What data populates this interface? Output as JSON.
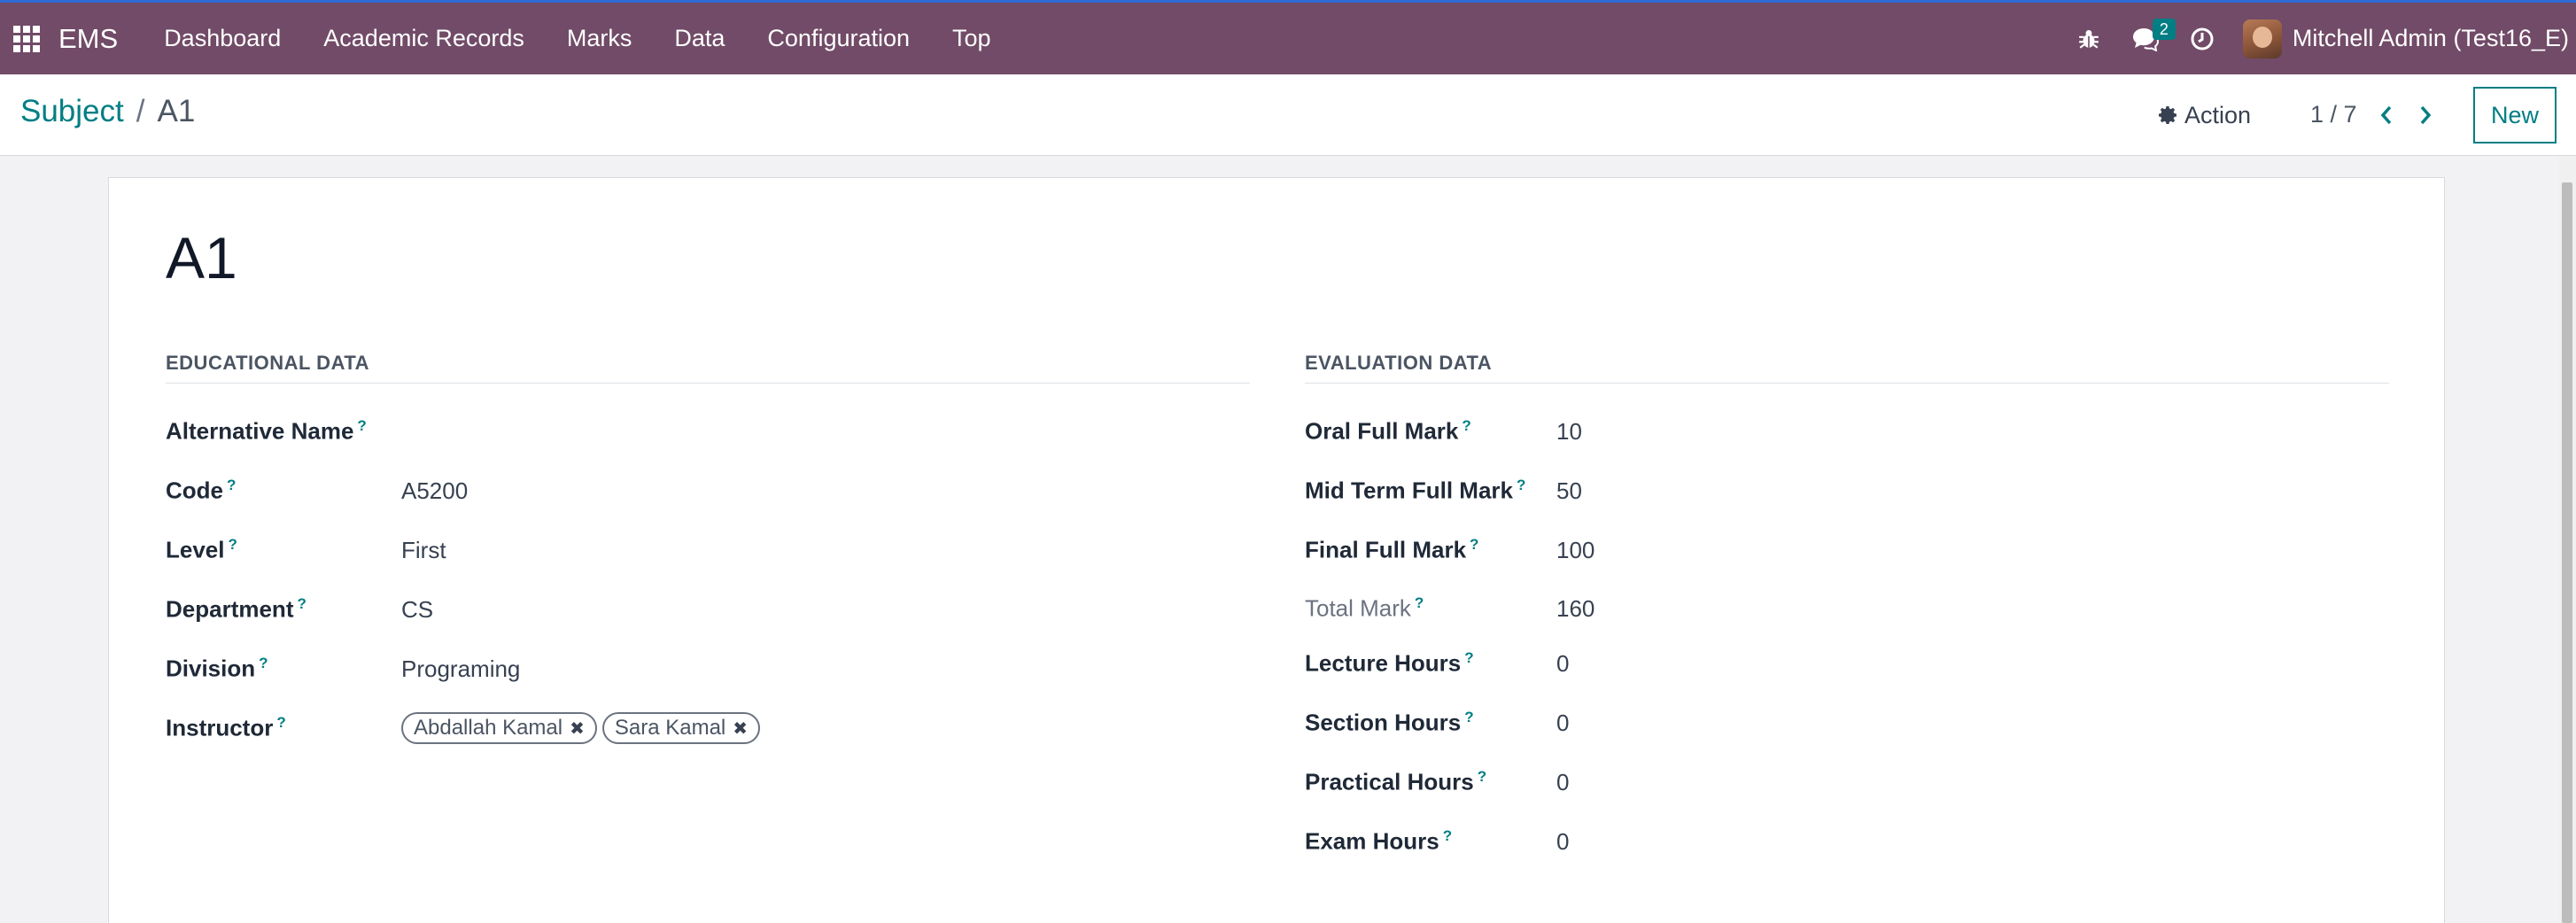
{
  "navbar": {
    "app_name": "EMS",
    "menu": [
      "Dashboard",
      "Academic Records",
      "Marks",
      "Data",
      "Configuration",
      "Top"
    ],
    "messages_count": "2",
    "user": "Mitchell Admin (Test16_E)"
  },
  "control": {
    "breadcrumb_parent": "Subject",
    "breadcrumb_sep": "/",
    "breadcrumb_current": "A1",
    "action_label": "Action",
    "pager": "1 / 7",
    "new_label": "New"
  },
  "record": {
    "title": "A1",
    "educational": {
      "title": "EDUCATIONAL DATA",
      "alt_name_label": "Alternative Name",
      "alt_name_value": "",
      "code_label": "Code",
      "code_value": "A5200",
      "level_label": "Level",
      "level_value": "First",
      "department_label": "Department",
      "department_value": "CS",
      "division_label": "Division",
      "division_value": "Programing",
      "instructor_label": "Instructor",
      "instructors": [
        "Abdallah Kamal",
        "Sara Kamal"
      ]
    },
    "evaluation": {
      "title": "EVALUATION DATA",
      "oral_label": "Oral Full Mark",
      "oral_value": "10",
      "mid_label": "Mid Term Full Mark",
      "mid_value": "50",
      "final_label": "Final Full Mark",
      "final_value": "100",
      "total_label": "Total Mark",
      "total_value": "160",
      "lecture_label": "Lecture Hours",
      "lecture_value": "0",
      "section_label": "Section Hours",
      "section_value": "0",
      "practical_label": "Practical Hours",
      "practical_value": "0",
      "exam_label": "Exam Hours",
      "exam_value": "0"
    }
  },
  "help_marker": "?",
  "colors": {
    "navbar": "#714b67",
    "accent": "#017e84"
  }
}
